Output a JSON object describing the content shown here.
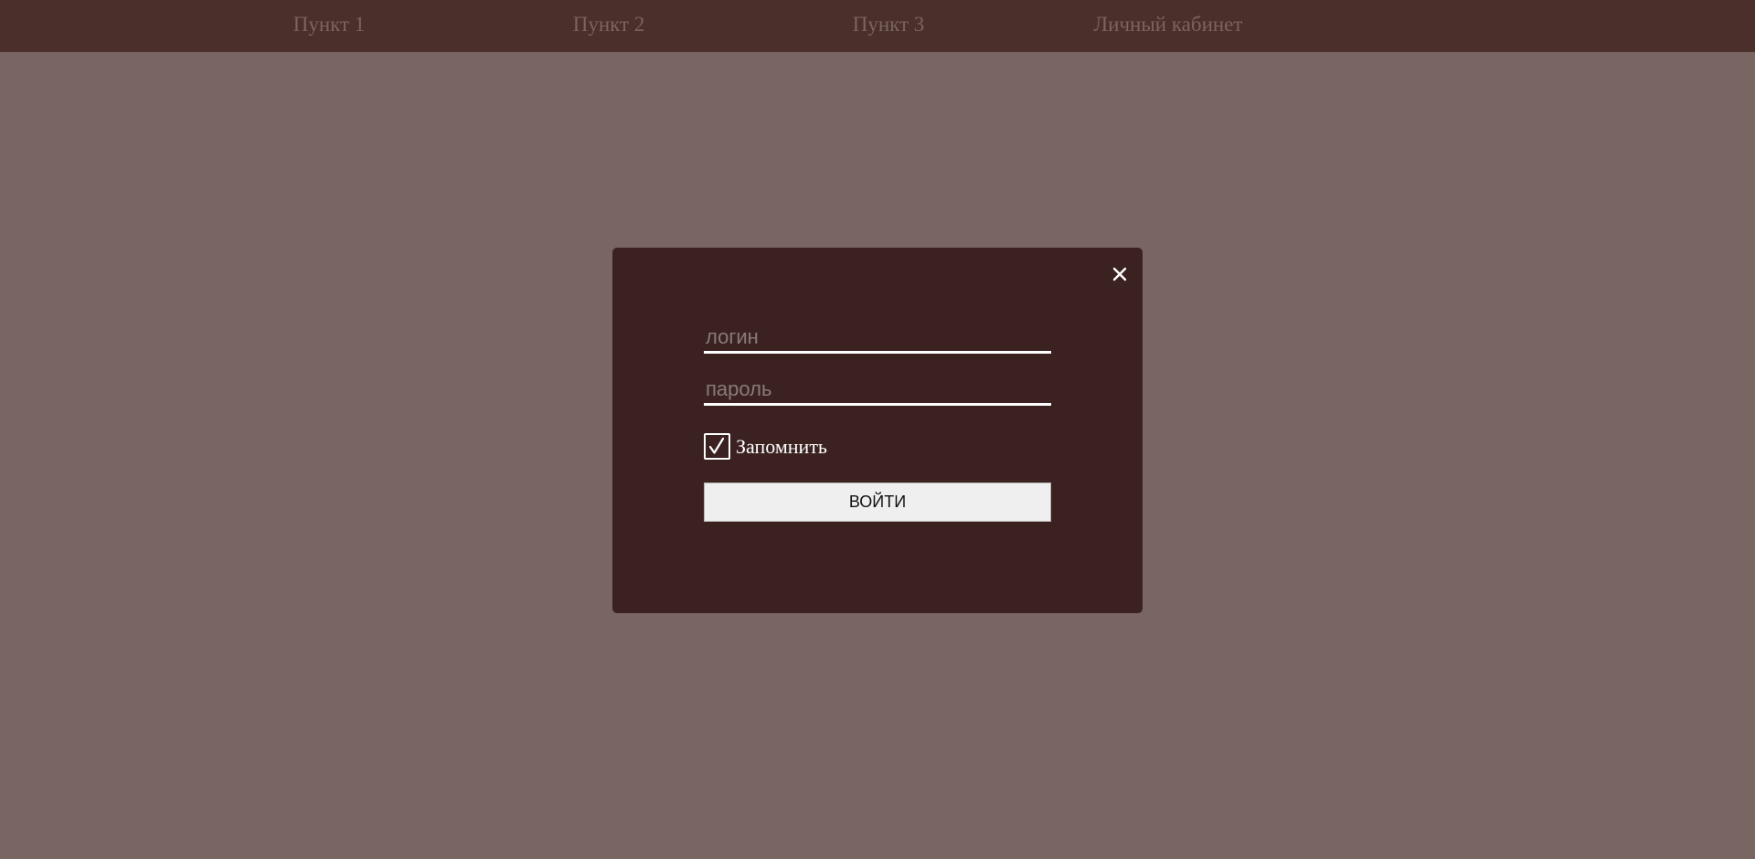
{
  "nav": {
    "items": [
      {
        "label": "Пункт 1"
      },
      {
        "label": "Пункт 2"
      },
      {
        "label": "Пункт 3"
      },
      {
        "label": "Личный кабинет"
      }
    ]
  },
  "login_modal": {
    "close_icon": "close-icon",
    "login_field": {
      "placeholder": "логин",
      "value": ""
    },
    "password_field": {
      "placeholder": "пароль",
      "value": ""
    },
    "remember": {
      "label": "Запомнить",
      "checked": true
    },
    "submit_label": "ВОЙТИ"
  },
  "colors": {
    "nav_background": "#4a2f2a",
    "nav_text": "#7b6461",
    "page_background": "#796663",
    "modal_background": "#3b2220",
    "button_background": "#efefef"
  }
}
